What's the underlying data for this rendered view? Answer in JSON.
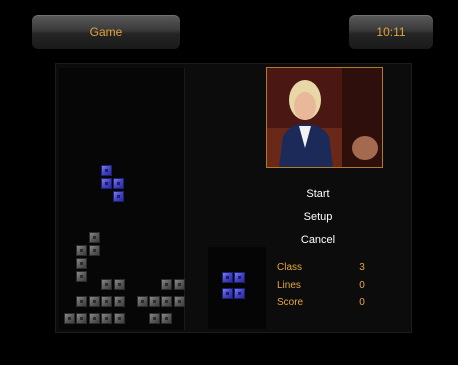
{
  "header": {
    "title": "Game",
    "clock": "10:11"
  },
  "menu": {
    "items": [
      "Start",
      "Setup",
      "Cancel"
    ]
  },
  "stats": [
    {
      "label": "Class",
      "value": "3"
    },
    {
      "label": "Lines",
      "value": "0"
    },
    {
      "label": "Score",
      "value": "0"
    }
  ],
  "colors": {
    "accent": "#e3a33a",
    "piece": "#4444c8",
    "block": "#6b6b6b"
  },
  "icons": {
    "video_preview": "live-tv-preview"
  }
}
